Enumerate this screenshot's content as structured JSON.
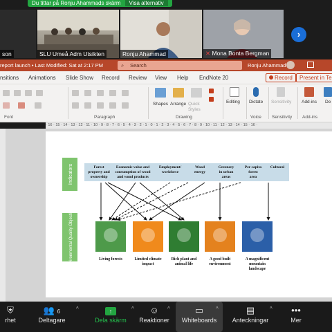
{
  "share_banner": {
    "text": "Du tittar på Ronju Ahammads skärm",
    "option": "Visa alternativ"
  },
  "videos": [
    {
      "name": "son"
    },
    {
      "name": "SLU Umeå Adm Utsikten"
    },
    {
      "name": "Ronju Ahammad"
    },
    {
      "name": "Mona Bonta Bergman"
    }
  ],
  "ppt": {
    "doc_title": "report launch • Last Modified: Sat at 2:17 PM",
    "search_placeholder": "Search",
    "user": "Ronju Ahammad",
    "tabs": [
      "nsitions",
      "Animations",
      "Slide Show",
      "Record",
      "Review",
      "View",
      "Help",
      "EndNote 20"
    ],
    "record_label": "Record",
    "present_label": "Present in Te",
    "ribbon": {
      "groups": [
        "Font",
        "Paragraph",
        "Drawing",
        "Voice",
        "Sensitivity",
        "Add-ins"
      ],
      "buttons": [
        "Shapes",
        "Arrange",
        "Quick Styles",
        "Editing",
        "Dictate",
        "Sensitivity",
        "Add-ins",
        "De"
      ]
    },
    "ruler_text": "· 16 · 15 · 14 · 13 · 12 · 11 · 10 · 9 · 8 · 7 · 6 · 5 · 4 · 3 · 2 · 1 · 0 · 1 · 2 · 3 · 4 · 5 · 6 · 7 · 8 · 9 · 10 · 11 · 12 · 13 · 14 · 15 · 16 ·"
  },
  "slide": {
    "indicators_label": "Indicators",
    "objectives_label": "Environmental Quality Objectives",
    "indicators": [
      "Forest property and ownership",
      "Economic value and consumption of wood and wood products",
      "Employment/ workforce",
      "Wood energy",
      "Greenery in urban areas",
      "Per capita forest area",
      "Cultural"
    ],
    "objectives": [
      "Living forests",
      "Limited climate impact",
      "Rich plant and animal life",
      "A good built environment",
      "A magnificent mountain landscape"
    ],
    "objective_colors": [
      "#4e9a4a",
      "#f08a1c",
      "#2f7d32",
      "#e4821e",
      "#2b5fa8"
    ]
  },
  "toolbar": {
    "items": [
      {
        "label": "rhet",
        "icon": "shield-icon"
      },
      {
        "label": "Deltagare",
        "count": "6",
        "icon": "participants-icon"
      },
      {
        "label": "Dela skärm",
        "icon": "share-screen-icon"
      },
      {
        "label": "Reaktioner",
        "icon": "reactions-icon"
      },
      {
        "label": "Whiteboards",
        "icon": "whiteboard-icon"
      },
      {
        "label": "Anteckningar",
        "icon": "notes-icon"
      },
      {
        "label": "Mer",
        "icon": "more-icon"
      }
    ]
  }
}
